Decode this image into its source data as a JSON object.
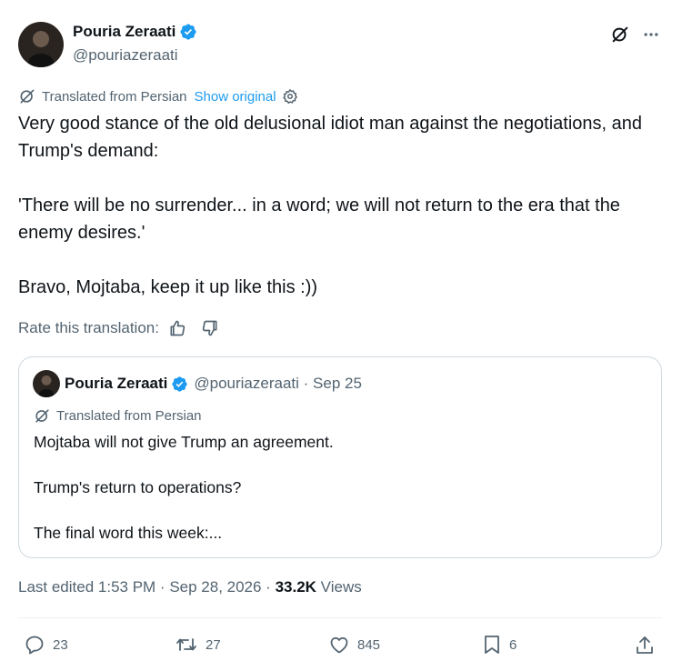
{
  "author": {
    "name": "Pouria Zeraati",
    "handle": "@pouriazeraati"
  },
  "translation": {
    "notice": "Translated from Persian",
    "show_original": "Show original",
    "rate_label": "Rate this translation:"
  },
  "post": {
    "paragraphs": [
      "Very good stance of the old delusional idiot man against the negotiations, and Trump's demand:",
      "'There will be no surrender... in a word; we will not return to the era that the enemy desires.'",
      "Bravo, Mojtaba, keep it up like this :))"
    ]
  },
  "quote": {
    "name": "Pouria Zeraati",
    "handle_date": "@pouriazeraati · Sep 25",
    "translation_notice": "Translated from Persian",
    "paragraphs": [
      "Mojtaba will not give Trump an agreement.",
      "Trump's return to operations?",
      "The final word this week:..."
    ]
  },
  "meta": {
    "edited": "Last edited 1:53 PM · Sep 28, 2026 · ",
    "views_count": "33.2K",
    "views_label": " Views"
  },
  "actions": {
    "replies": "23",
    "reposts": "27",
    "likes": "845",
    "bookmarks": "6"
  },
  "icons": [
    "verified-icon",
    "grok-icon",
    "more-icon",
    "translate-icon",
    "settings-icon",
    "thumbs-up-icon",
    "thumbs-down-icon",
    "reply-icon",
    "repost-icon",
    "like-icon",
    "bookmark-icon",
    "share-icon"
  ],
  "colors": {
    "accent": "#1d9bf0",
    "muted": "#536471",
    "text": "#0f1419",
    "border": "#cfd9de"
  }
}
